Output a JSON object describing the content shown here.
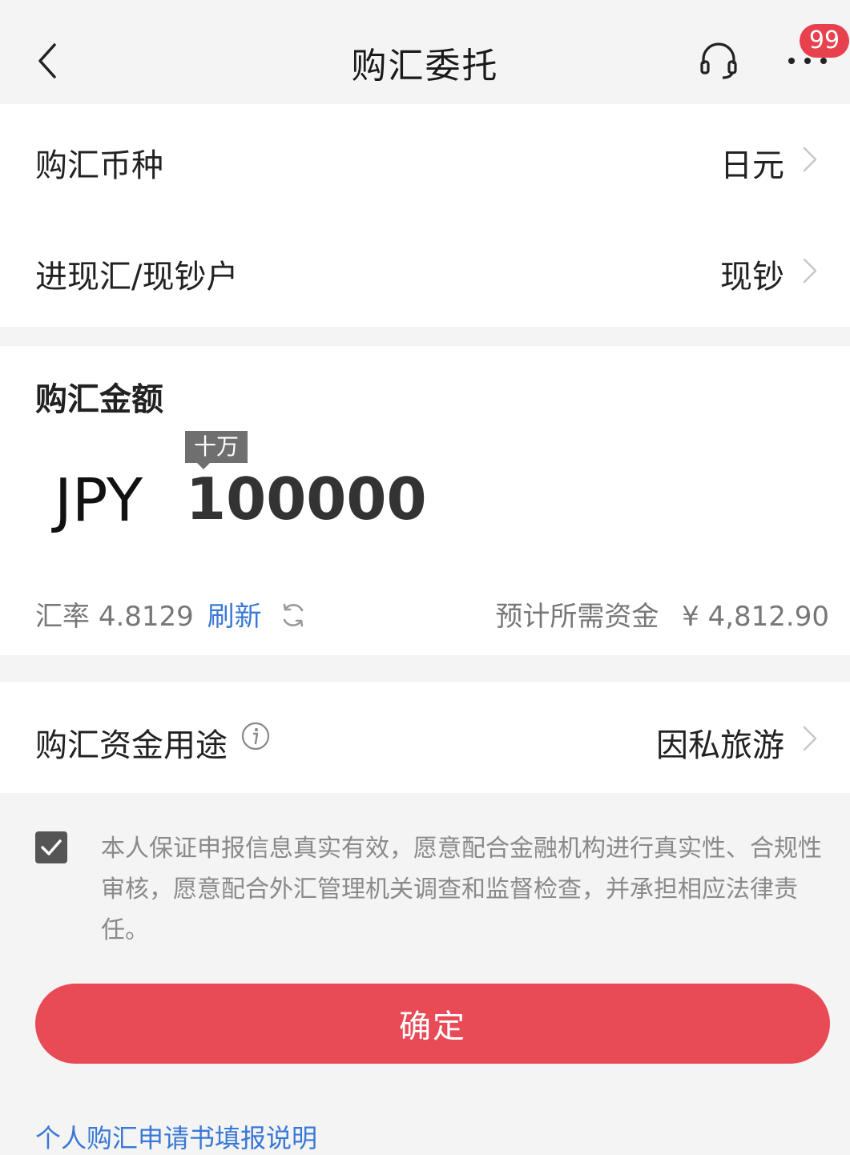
{
  "header": {
    "title": "购汇委托",
    "back_icon": "chevron-left-icon",
    "service_icon": "headset-icon",
    "more_icon": "more-dots-icon",
    "badge": "99"
  },
  "rows": [
    {
      "label": "购汇币种",
      "value": "日元"
    },
    {
      "label": "进现汇/现钞户",
      "value": "现钞"
    }
  ],
  "amount": {
    "label": "购汇金额",
    "currency": "JPY",
    "value": "100000",
    "unit_hint": "十万"
  },
  "rate": {
    "label": "汇率",
    "value": "4.8129",
    "refresh_label": "刷新",
    "required_label": "预计所需资金",
    "required_value": "¥ 4,812.90"
  },
  "purpose": {
    "label": "购汇资金用途",
    "value": "因私旅游"
  },
  "agreement": {
    "checked": true,
    "text": "本人保证申报信息真实有效，愿意配合金融机构进行真实性、合规性审核，愿意配合外汇管理机关调查和监督检查，并承担相应法律责任。"
  },
  "confirm_label": "确定",
  "bottom_link": "个人购汇申请书填报说明",
  "colors": {
    "accent": "#e84a56",
    "link": "#3a78d6",
    "badge": "#e8414e"
  }
}
